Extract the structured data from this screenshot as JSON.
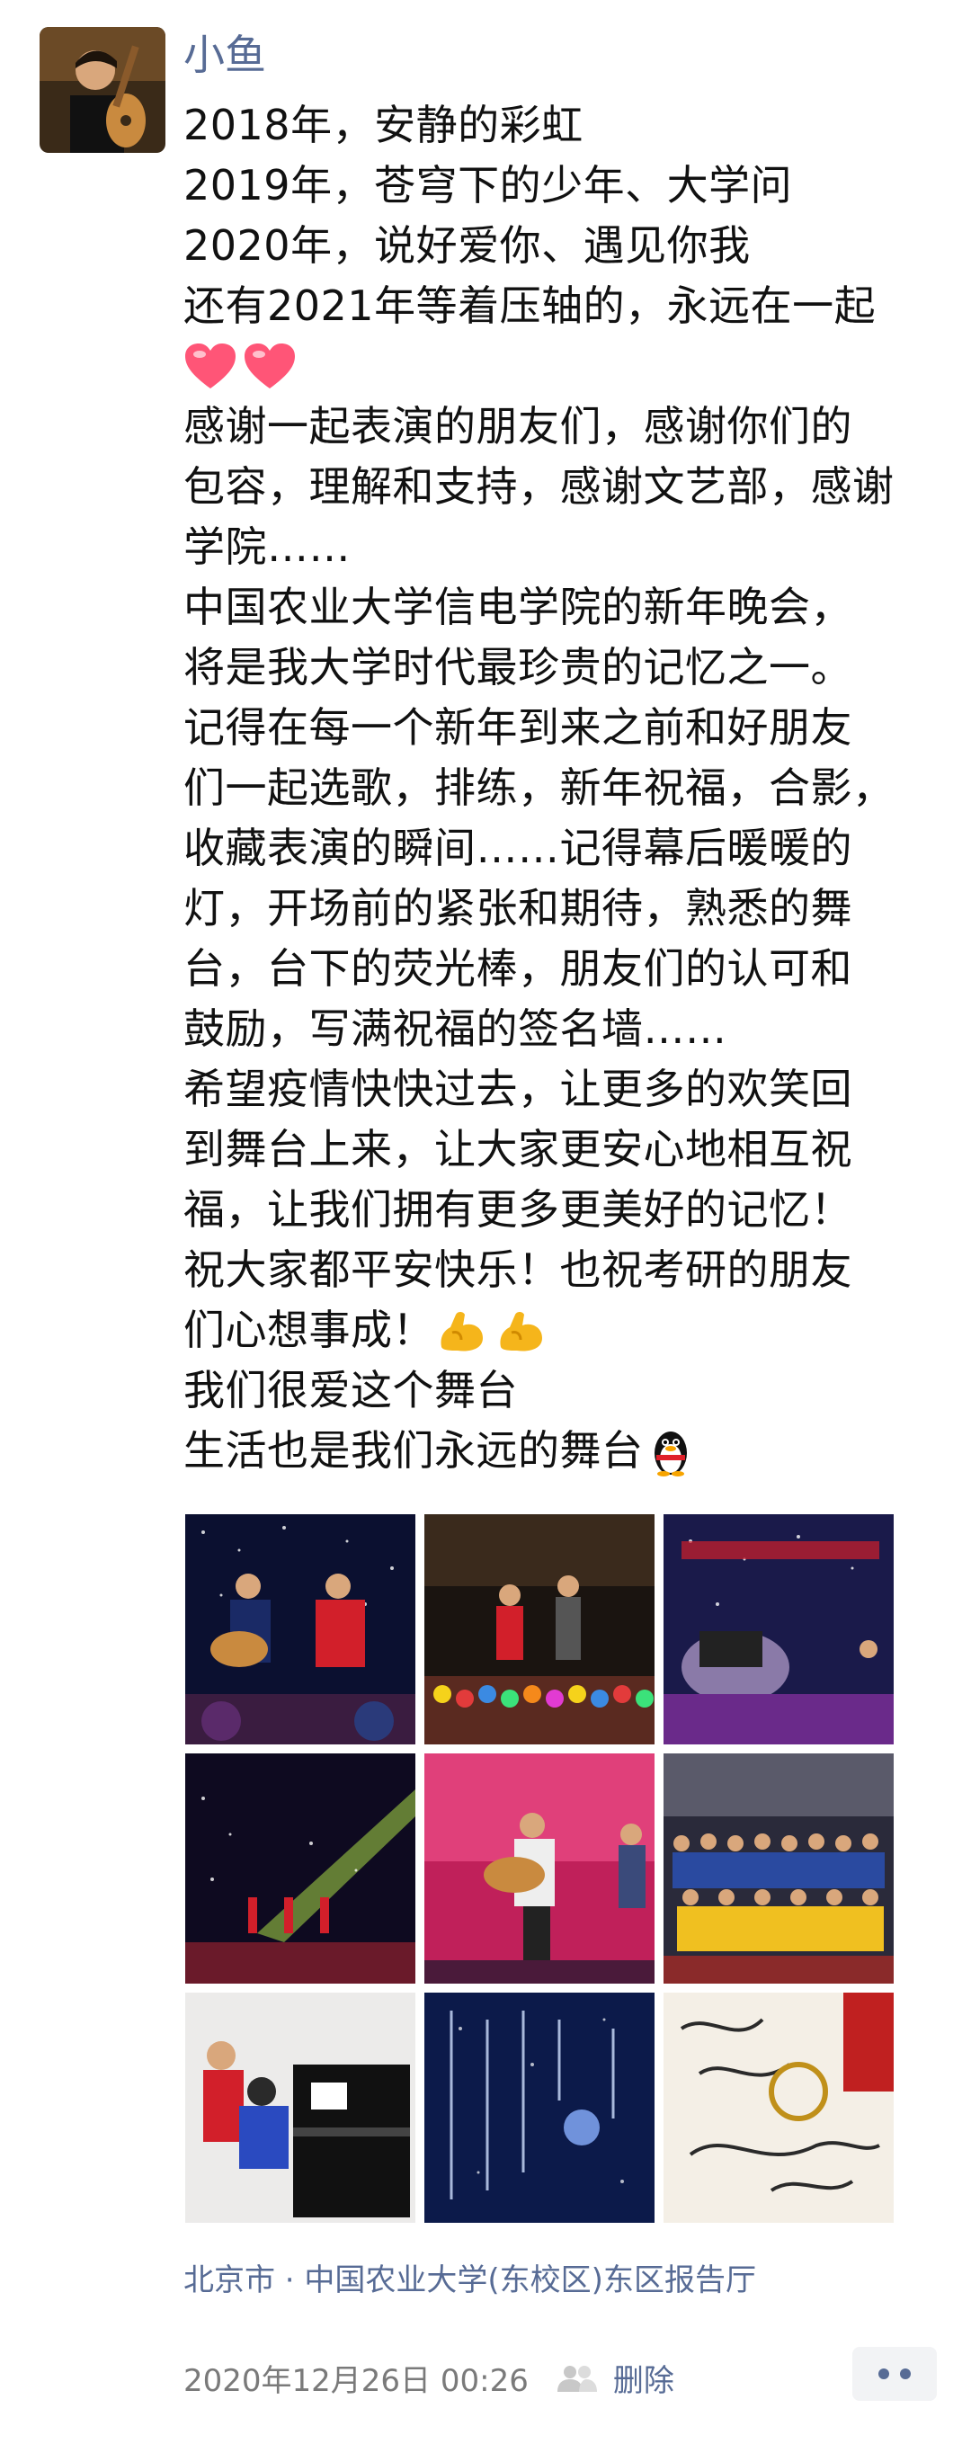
{
  "post": {
    "author": "小鱼",
    "lines": [
      "2018年，安静的彩虹",
      "2019年，苍穹下的少年、大学问",
      "2020年，说好爱你、遇见你我",
      "还有2021年等着压轴的，永远在一起",
      "",
      "感谢一起表演的朋友们，感谢你们的",
      "包容，理解和支持，感谢文艺部，感谢",
      "学院……",
      "中国农业大学信电学院的新年晚会，",
      "将是我大学时代最珍贵的记忆之一。",
      "记得在每一个新年到来之前和好朋友",
      "们一起选歌，排练，新年祝福，合影，",
      "收藏表演的瞬间……记得幕后暖暖的",
      "灯，开场前的紧张和期待，熟悉的舞",
      "台，台下的荧光棒，朋友们的认可和",
      "鼓励，写满祝福的签名墙……",
      "希望疫情快快过去，让更多的欢笑回",
      "到舞台上来，让大家更安心地相互祝",
      "福，让我们拥有更多更美好的记忆！",
      "祝大家都平安快乐！也祝考研的朋友",
      "们心想事成！",
      "我们很爱这个舞台",
      "生活也是我们永远的舞台"
    ],
    "emoji_names": [
      "heart-icon",
      "heart-icon",
      "flexed-biceps-icon",
      "flexed-biceps-icon",
      "penguin-icon"
    ],
    "photos": [
      {
        "name": "photo-guitar-duo"
      },
      {
        "name": "photo-singers-stage"
      },
      {
        "name": "photo-piano-stage"
      },
      {
        "name": "photo-spotlight-stage"
      },
      {
        "name": "photo-guitar-performer"
      },
      {
        "name": "photo-group-photo"
      },
      {
        "name": "photo-piano-practice"
      },
      {
        "name": "photo-blue-calligraphy"
      },
      {
        "name": "photo-signature-wall"
      }
    ],
    "location": "北京市 · 中国农业大学(东校区)东区报告厅",
    "timestamp": "2020年12月26日 00:26",
    "delete_label": "删除"
  },
  "colors": {
    "link": "#576b95",
    "text": "#111111",
    "meta": "#7a7a7a"
  }
}
